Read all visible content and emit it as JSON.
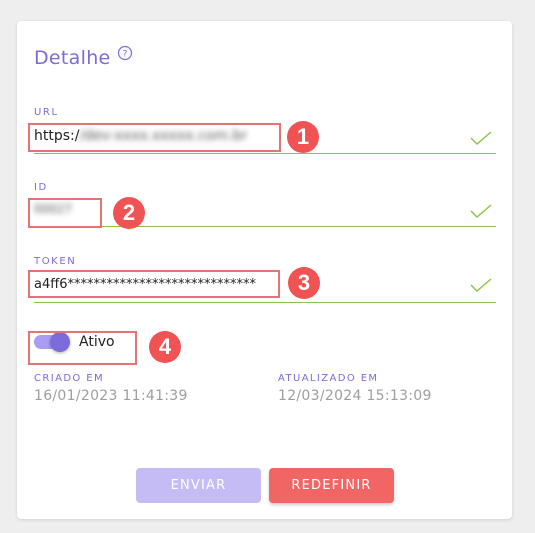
{
  "card": {
    "title": "Detalhe"
  },
  "fields": {
    "url": {
      "label": "URL",
      "value_visible": "https:/",
      "value_obscured": "/dev-xxxx.xxxxx.com.br"
    },
    "id": {
      "label": "ID",
      "value_obscured": "00027"
    },
    "token": {
      "label": "TOKEN",
      "value": "a4ff6*****************************"
    }
  },
  "toggle": {
    "label": "Ativo",
    "checked": true
  },
  "meta": {
    "created_label": "CRIADO EM",
    "created_value": "16/01/2023 11:41:39",
    "updated_label": "ATUALIZADO EM",
    "updated_value": "12/03/2024 15:13:09"
  },
  "buttons": {
    "send_label": "ENVIAR",
    "reset_label": "REDEFINIR"
  },
  "annotations": [
    "1",
    "2",
    "3",
    "4"
  ],
  "colors": {
    "accent": "#7b6cd9",
    "valid_line": "#8bc34a",
    "danger": "#f26565",
    "badge": "#f05353"
  }
}
